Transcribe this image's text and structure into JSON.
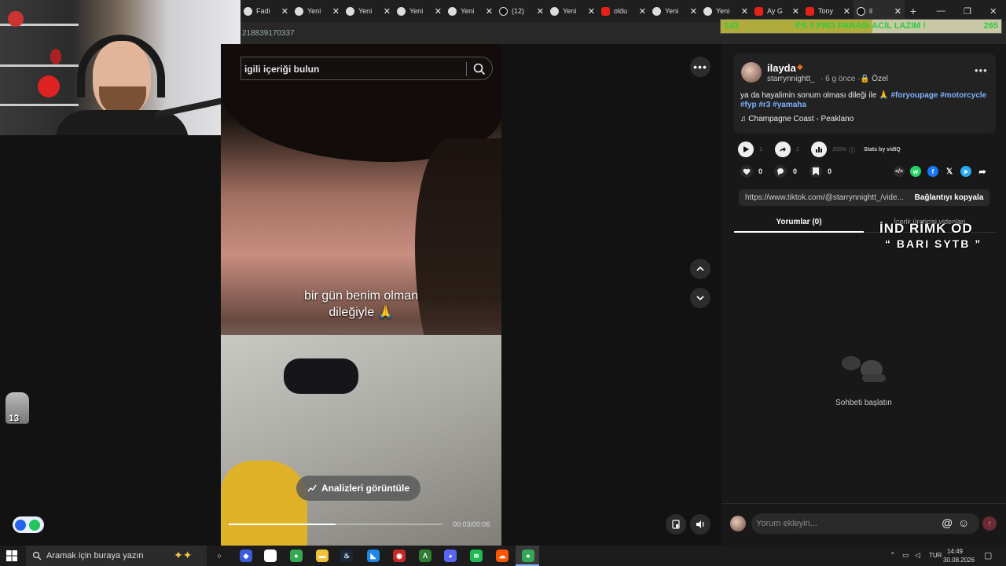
{
  "browser": {
    "tabs": [
      {
        "label": "Fadi",
        "icon": "globe-icon",
        "kind": "web"
      },
      {
        "label": "Yeni",
        "icon": "chrome-icon",
        "kind": "web"
      },
      {
        "label": "Yeni",
        "icon": "chrome-icon",
        "kind": "web"
      },
      {
        "label": "Yeni",
        "icon": "chrome-icon",
        "kind": "web"
      },
      {
        "label": "Yeni",
        "icon": "chrome-icon",
        "kind": "web"
      },
      {
        "label": "(12)",
        "icon": "tiktok-icon",
        "kind": "tt"
      },
      {
        "label": "Yeni",
        "icon": "chrome-icon",
        "kind": "web"
      },
      {
        "label": "oldu",
        "icon": "youtube-icon",
        "kind": "yt"
      },
      {
        "label": "Yeni",
        "icon": "chrome-icon",
        "kind": "web"
      },
      {
        "label": "Yeni",
        "icon": "chrome-icon",
        "kind": "web"
      },
      {
        "label": "Ay G",
        "icon": "youtube-icon",
        "kind": "yt"
      },
      {
        "label": "Tony",
        "icon": "youtube-icon",
        "kind": "yt"
      },
      {
        "label": "il",
        "icon": "tiktok-icon",
        "kind": "tt",
        "active": true
      }
    ],
    "url_fragment": "218839170337",
    "window_controls": {
      "minimize": "—",
      "restore": "❐",
      "close": "✕"
    }
  },
  "donation": {
    "left_number": "143",
    "goal_text": "PS 5 PRO PARASI ACİL LAZIM !",
    "right_number": "265",
    "progress_fraction": 0.54
  },
  "video": {
    "search_placeholder": "igili içeriği bulun",
    "caption_line1": "bir gün benim olman",
    "caption_line2": "dileğiyle 🙏",
    "analytics_label": "Analizleri görüntüle",
    "time": "00:03/00:06",
    "progress_fraction": 0.5
  },
  "post": {
    "username": "ilayda",
    "handle": "starrynnightt_",
    "time_ago": "· 6 g önce ·",
    "privacy": "Özel",
    "description_text": "ya da hayalimin sonum olması dileği ile 🙏",
    "hashtags_line1": "#foryoupage #motorcycle",
    "hashtags_line2": "#fyp #r3 #yamaha",
    "music": "Champagne Coast - Peaklano",
    "stats": {
      "plays": "1",
      "shares": "2",
      "percent": "200%",
      "source": "Stats by vidIQ"
    },
    "likes": "0",
    "comments": "0",
    "saves": "0",
    "link": "https://www.tiktok.com/@starrynnightt_/vide...",
    "copy_label": "Bağlantıyı kopyala"
  },
  "comments_panel": {
    "tab_comments": "Yorumlar (0)",
    "tab_creator": "İçerik üreticisi videoları",
    "empty_text": "Sohbeti başlatın",
    "input_placeholder": "Yorum ekleyin..."
  },
  "stream_overlay": {
    "title_line1": "İND RİMK OD",
    "title_line2": "“ BARI SYTB ”",
    "sticker_text": "13"
  },
  "taskbar": {
    "search_placeholder": "Aramak için buraya yazın",
    "language": "TUR",
    "time": "14:49",
    "date": "30.08.2026"
  },
  "colors": {
    "accent_link": "#7fb2ff",
    "donation_text": "#2ecc40",
    "whatsapp": "#25d366",
    "facebook": "#1877f2",
    "telegram": "#2aabee"
  }
}
